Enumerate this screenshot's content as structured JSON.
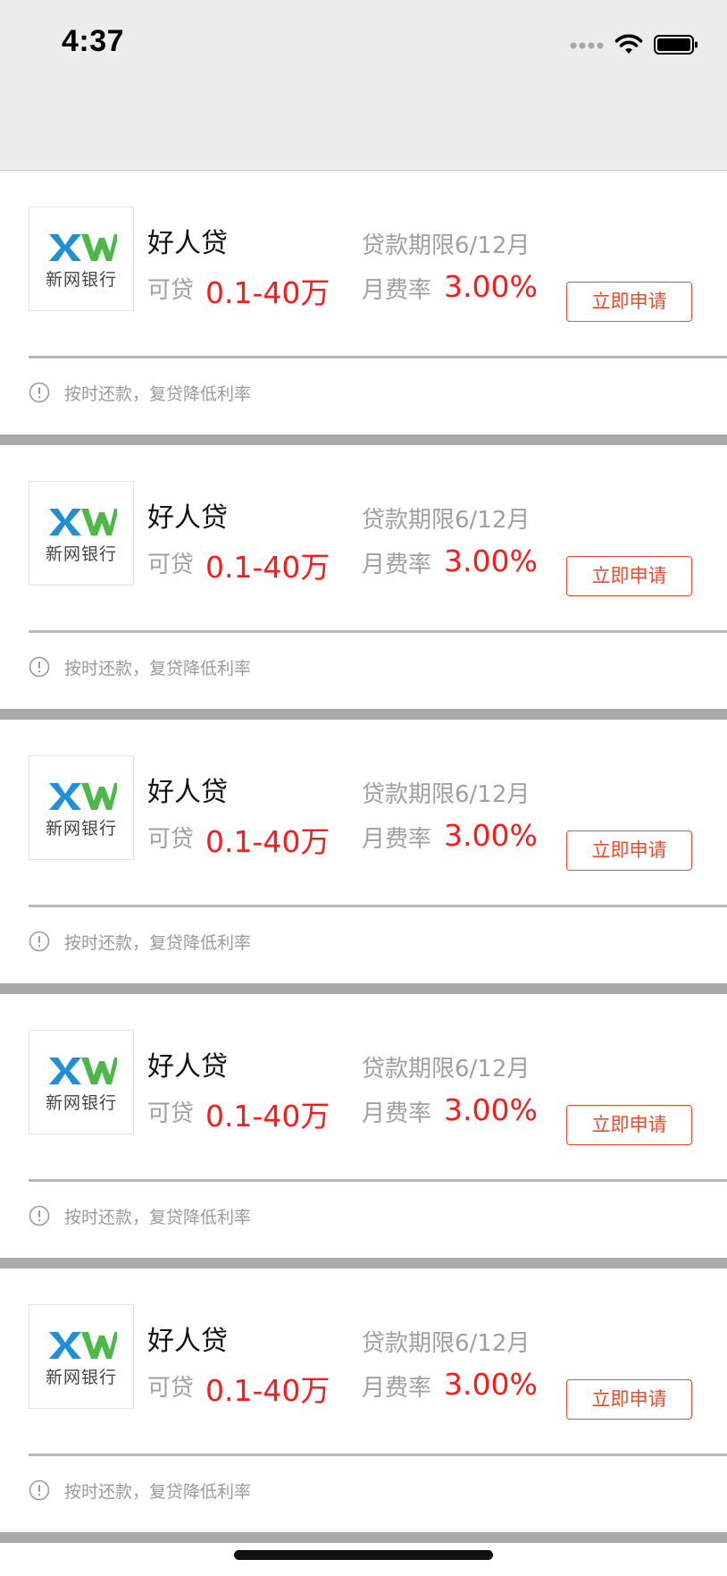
{
  "status_bar": {
    "time": "4:37"
  },
  "loans": [
    {
      "bank_logo_text": "新网银行",
      "product_name": "好人贷",
      "amount_label": "可贷",
      "amount_value": "0.1-40万",
      "term_text": "贷款期限6/12月",
      "rate_label": "月费率",
      "rate_value": "3.00%",
      "apply_label": "立即申请",
      "tip": "按时还款，复贷降低利率"
    },
    {
      "bank_logo_text": "新网银行",
      "product_name": "好人贷",
      "amount_label": "可贷",
      "amount_value": "0.1-40万",
      "term_text": "贷款期限6/12月",
      "rate_label": "月费率",
      "rate_value": "3.00%",
      "apply_label": "立即申请",
      "tip": "按时还款，复贷降低利率"
    },
    {
      "bank_logo_text": "新网银行",
      "product_name": "好人贷",
      "amount_label": "可贷",
      "amount_value": "0.1-40万",
      "term_text": "贷款期限6/12月",
      "rate_label": "月费率",
      "rate_value": "3.00%",
      "apply_label": "立即申请",
      "tip": "按时还款，复贷降低利率"
    },
    {
      "bank_logo_text": "新网银行",
      "product_name": "好人贷",
      "amount_label": "可贷",
      "amount_value": "0.1-40万",
      "term_text": "贷款期限6/12月",
      "rate_label": "月费率",
      "rate_value": "3.00%",
      "apply_label": "立即申请",
      "tip": "按时还款，复贷降低利率"
    },
    {
      "bank_logo_text": "新网银行",
      "product_name": "好人贷",
      "amount_label": "可贷",
      "amount_value": "0.1-40万",
      "term_text": "贷款期限6/12月",
      "rate_label": "月费率",
      "rate_value": "3.00%",
      "apply_label": "立即申请",
      "tip": "按时还款，复贷降低利率"
    }
  ],
  "colors": {
    "accent_red": "#ff1a1a",
    "button_orange": "#ef4a2c",
    "logo_blue": "#1f8fd6",
    "logo_green": "#4cb848"
  },
  "icons": [
    "cellular-signal-icon",
    "wifi-icon",
    "battery-icon",
    "bank-logo-icon",
    "info-circle-icon"
  ]
}
